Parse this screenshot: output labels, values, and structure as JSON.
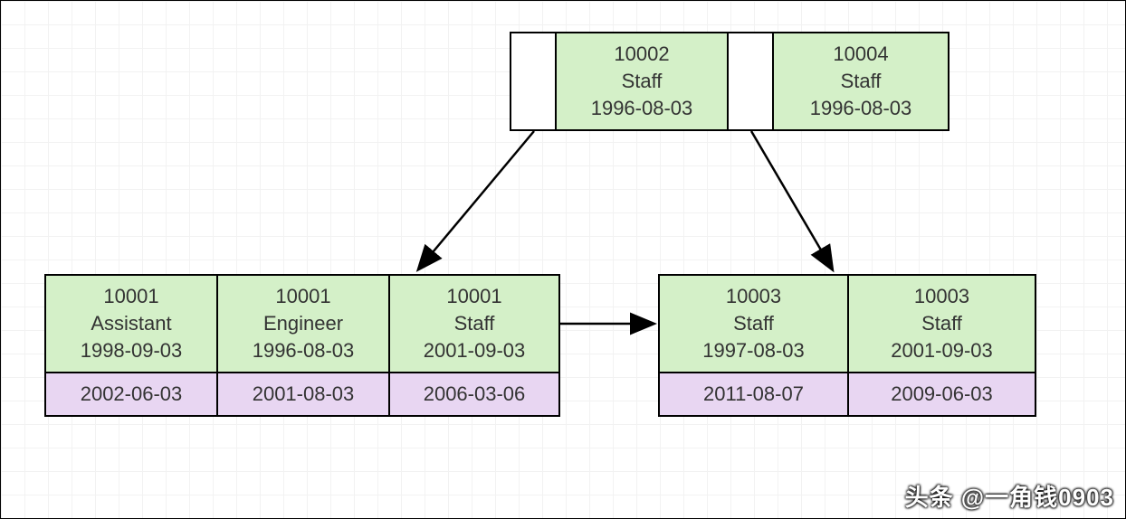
{
  "root": {
    "cells": [
      {
        "id": "10002",
        "role": "Staff",
        "date": "1996-08-03"
      },
      {
        "id": "10004",
        "role": "Staff",
        "date": "1996-08-03"
      }
    ]
  },
  "left_child": {
    "cells": [
      {
        "id": "10001",
        "role": "Assistant",
        "date": "1998-09-03",
        "footer": "2002-06-03"
      },
      {
        "id": "10001",
        "role": "Engineer",
        "date": "1996-08-03",
        "footer": "2001-08-03"
      },
      {
        "id": "10001",
        "role": "Staff",
        "date": "2001-09-03",
        "footer": "2006-03-06"
      }
    ]
  },
  "right_child": {
    "cells": [
      {
        "id": "10003",
        "role": "Staff",
        "date": "1997-08-03",
        "footer": "2011-08-07"
      },
      {
        "id": "10003",
        "role": "Staff",
        "date": "2001-09-03",
        "footer": "2009-06-03"
      }
    ]
  },
  "watermark": "头条 @一角钱0903"
}
